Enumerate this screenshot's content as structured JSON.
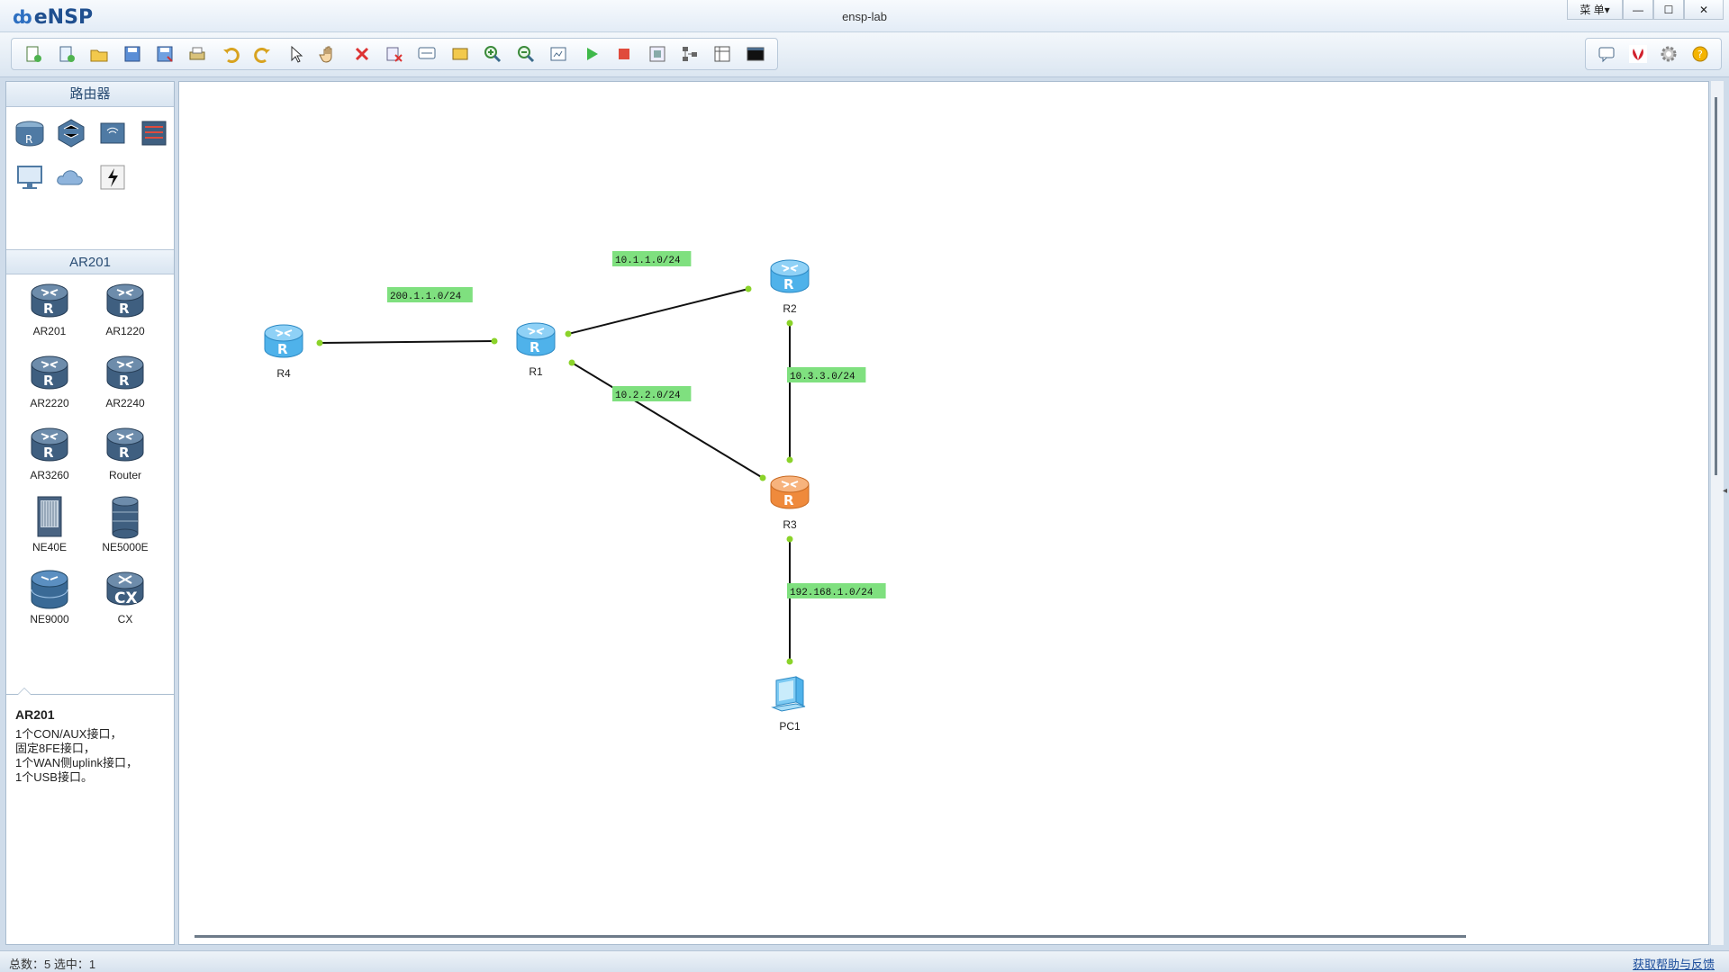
{
  "window": {
    "app_name": "eNSP",
    "title": "ensp-lab",
    "menu_label": "菜 单▾",
    "minimize": "—",
    "maximize": "☐",
    "close": "✕"
  },
  "toolbar": {
    "left_icons": [
      "new-topology-icon",
      "new-example-icon",
      "open-icon",
      "save-icon",
      "save-as-icon",
      "print-icon",
      "undo-icon",
      "redo-icon",
      "select-pointer-icon",
      "pan-hand-icon",
      "delete-icon",
      "delete-link-icon",
      "add-text-icon",
      "palette-icon",
      "zoom-in-icon",
      "zoom-out-icon",
      "fit-view-icon",
      "start-device-icon",
      "stop-device-icon",
      "capture-icon",
      "topology-icon",
      "grid-icon",
      "terminal-icon"
    ],
    "right_icons": [
      "chat-icon",
      "huawei-logo-icon",
      "settings-gear-icon",
      "help-icon"
    ]
  },
  "left_panel": {
    "category_title": "路由器",
    "category_icons": [
      "router-category-icon",
      "switch-category-icon",
      "wlan-category-icon",
      "firewall-category-icon",
      "pc-category-icon",
      "cloud-category-icon",
      "connection-category-icon"
    ],
    "device_title": "AR201",
    "devices": [
      {
        "label": "AR201",
        "type": "router"
      },
      {
        "label": "AR1220",
        "type": "router"
      },
      {
        "label": "AR2220",
        "type": "router"
      },
      {
        "label": "AR2240",
        "type": "router"
      },
      {
        "label": "AR3260",
        "type": "router"
      },
      {
        "label": "Router",
        "type": "router"
      },
      {
        "label": "NE40E",
        "type": "chassis"
      },
      {
        "label": "NE5000E",
        "type": "stack"
      },
      {
        "label": "NE9000",
        "type": "stack-blue"
      },
      {
        "label": "CX",
        "type": "cx"
      }
    ],
    "description": {
      "title": "AR201",
      "lines": [
        "1个CON/AUX接口，",
        "固定8FE接口，",
        "1个WAN侧uplink接口，",
        "1个USB接口。"
      ]
    }
  },
  "topology": {
    "nodes": [
      {
        "id": "R4",
        "label": "R4",
        "kind": "router",
        "color": "blue"
      },
      {
        "id": "R1",
        "label": "R1",
        "kind": "router",
        "color": "blue"
      },
      {
        "id": "R2",
        "label": "R2",
        "kind": "router",
        "color": "blue"
      },
      {
        "id": "R3",
        "label": "R3",
        "kind": "router",
        "color": "orange"
      },
      {
        "id": "PC1",
        "label": "PC1",
        "kind": "pc",
        "color": "blue"
      }
    ],
    "links": [
      {
        "from": "R4",
        "to": "R1"
      },
      {
        "from": "R1",
        "to": "R2"
      },
      {
        "from": "R1",
        "to": "R3"
      },
      {
        "from": "R2",
        "to": "R3"
      },
      {
        "from": "R3",
        "to": "PC1"
      }
    ],
    "network_labels": [
      "200.1.1.0/24",
      "10.1.1.0/24",
      "10.2.2.0/24",
      "10.3.3.0/24",
      "192.168.1.0/24"
    ],
    "colors": {
      "label_bg": "#7fe07f",
      "port_dot": "#8bd32a",
      "link": "#111111",
      "router_blue": "#5bb8ee",
      "router_orange": "#f08a3c"
    }
  },
  "status_bar": {
    "left_text": "总数：5 选中：1",
    "right_text": "获取帮助与反馈"
  }
}
